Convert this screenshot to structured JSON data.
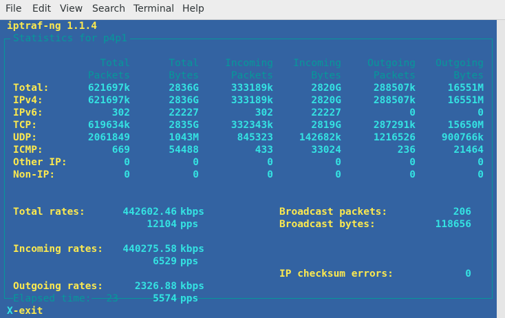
{
  "menu": [
    "File",
    "Edit",
    "View",
    "Search",
    "Terminal",
    "Help"
  ],
  "app_title": "iptraf-ng 1.1.4",
  "window_title": "Statistics for p4p1",
  "columns": [
    [
      "Total",
      "Packets"
    ],
    [
      "Total",
      "Bytes"
    ],
    [
      "Incoming",
      "Packets"
    ],
    [
      "Incoming",
      "Bytes"
    ],
    [
      "Outgoing",
      "Packets"
    ],
    [
      "Outgoing",
      "Bytes"
    ]
  ],
  "rows": [
    {
      "label": "Total:",
      "values": [
        "621697k",
        "2836G",
        "333189k",
        "2820G",
        "288507k",
        "16551M"
      ]
    },
    {
      "label": "IPv4:",
      "values": [
        "621697k",
        "2836G",
        "333189k",
        "2820G",
        "288507k",
        "16551M"
      ]
    },
    {
      "label": "IPv6:",
      "values": [
        "302",
        "22227",
        "302",
        "22227",
        "0",
        "0"
      ]
    },
    {
      "label": "TCP:",
      "values": [
        "619634k",
        "2835G",
        "332343k",
        "2819G",
        "287291k",
        "15650M"
      ]
    },
    {
      "label": "UDP:",
      "values": [
        "2061849",
        "1043M",
        "845323",
        "142682k",
        "1216526",
        "900766k"
      ]
    },
    {
      "label": "ICMP:",
      "values": [
        "669",
        "54488",
        "433",
        "33024",
        "236",
        "21464"
      ]
    },
    {
      "label": "Other IP:",
      "values": [
        "0",
        "0",
        "0",
        "0",
        "0",
        "0"
      ]
    },
    {
      "label": "Non-IP:",
      "values": [
        "0",
        "0",
        "0",
        "0",
        "0",
        "0"
      ]
    }
  ],
  "rates": {
    "total": {
      "label": "Total rates:",
      "kbps": "442602.46",
      "pps": "12104"
    },
    "incoming": {
      "label": "Incoming rates:",
      "kbps": "440275.58",
      "pps": "6529"
    },
    "outgoing": {
      "label": "Outgoing rates:",
      "kbps": "2326.88",
      "pps": "5574"
    },
    "kbps_unit": "kbps",
    "pps_unit": "pps"
  },
  "broadcast_packets": {
    "label": "Broadcast packets:",
    "value": "206"
  },
  "broadcast_bytes": {
    "label": "Broadcast bytes:",
    "value": "118656"
  },
  "checksum_errors": {
    "label": "IP checksum errors:",
    "value": "0"
  },
  "elapsed": {
    "label": "Elapsed time:",
    "value": "23"
  },
  "footer": {
    "key": "X",
    "action": "-exit"
  }
}
